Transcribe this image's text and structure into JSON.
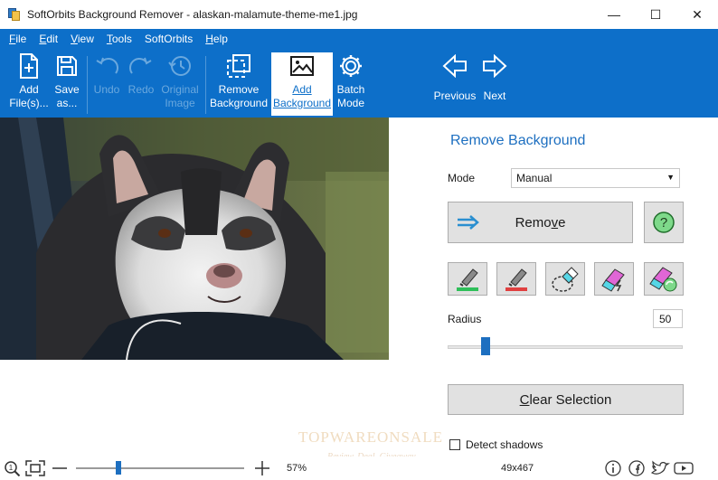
{
  "window": {
    "title": "SoftOrbits Background Remover - alaskan-malamute-theme-me1.jpg",
    "minimize": "—",
    "maximize": "☐",
    "close": "✕"
  },
  "menu": {
    "items": [
      {
        "name": "menu-file",
        "label": "File"
      },
      {
        "name": "menu-edit",
        "label": "Edit"
      },
      {
        "name": "menu-view",
        "label": "View"
      },
      {
        "name": "menu-tools",
        "label": "Tools"
      },
      {
        "name": "menu-softorbits",
        "label": "SoftOrbits"
      },
      {
        "name": "menu-help",
        "label": "Help"
      }
    ]
  },
  "toolbar": {
    "add_files": [
      "Add",
      "File(s)..."
    ],
    "save_as": [
      "Save",
      "as..."
    ],
    "undo": "Undo",
    "redo": "Redo",
    "original_image": [
      "Original",
      "Image"
    ],
    "remove_background": [
      "Remove",
      "Background"
    ],
    "add_background": [
      "Add",
      "Background"
    ],
    "batch_mode": [
      "Batch",
      "Mode"
    ],
    "previous": "Previous",
    "next": "Next"
  },
  "panel": {
    "title": "Remove Background",
    "mode_label": "Mode",
    "mode_value": "Manual",
    "remove_label": "Remove",
    "help_glyph": "?",
    "radius_label": "Radius",
    "radius_value": "50",
    "radius_level": 50,
    "clear_label": "Clear Selection",
    "detect_shadows_label": "Detect shadows",
    "detect_shadows_checked": false
  },
  "watermark": {
    "main": "TOPWAREONSALE",
    "sub": "Review. Deal. Giveaway"
  },
  "status": {
    "zoom_percent": "57%",
    "zoom_level": 0.57,
    "dimensions": "49x467"
  },
  "colors": {
    "ribbon": "#0d6fc9",
    "accent": "#1d6fc0",
    "button": "#e1e1e1"
  }
}
